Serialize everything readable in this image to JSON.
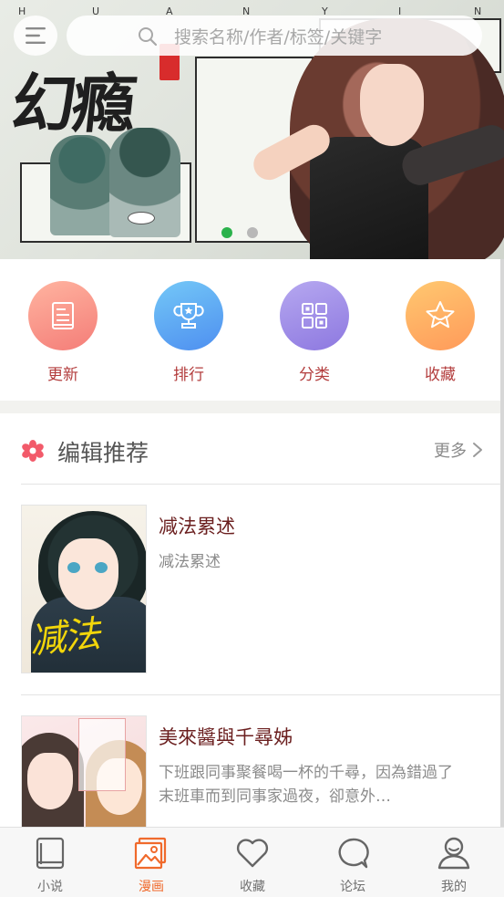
{
  "banner": {
    "letters": [
      "H",
      "U",
      "A",
      "N",
      "Y",
      "I",
      "N"
    ],
    "stamp_text": "",
    "title_art": "幻瘾",
    "slides_count": 2,
    "active_slide": 1
  },
  "search": {
    "placeholder": "搜索名称/作者/标签/关键字"
  },
  "quick_nav": [
    {
      "label": "更新",
      "icon": "book-icon",
      "color_from": "#ffb4a0",
      "color_to": "#f47d78"
    },
    {
      "label": "排行",
      "icon": "trophy-icon",
      "color_from": "#74c8f7",
      "color_to": "#4e8ff0"
    },
    {
      "label": "分类",
      "icon": "grid-icon",
      "color_from": "#b6a8f0",
      "color_to": "#8d78e0"
    },
    {
      "label": "收藏",
      "icon": "star-icon",
      "color_from": "#ffc870",
      "color_to": "#ff9a5a"
    }
  ],
  "editor_picks": {
    "title": "编辑推荐",
    "more_label": "更多",
    "items": [
      {
        "title": "减法累述",
        "description": "减法累述"
      },
      {
        "title": "美來醬與千尋姊",
        "description": "下班跟同事聚餐喝一杯的千尋，因為錯過了末班車而到同事家過夜，卻意外…"
      }
    ]
  },
  "tabs": [
    {
      "label": "小说",
      "icon": "novel-book-icon",
      "active": false
    },
    {
      "label": "漫画",
      "icon": "comic-picture-icon",
      "active": true
    },
    {
      "label": "收藏",
      "icon": "heart-icon",
      "active": false
    },
    {
      "label": "论坛",
      "icon": "chat-bubble-icon",
      "active": false
    },
    {
      "label": "我的",
      "icon": "user-icon",
      "active": false
    }
  ],
  "colors": {
    "accent": "#f06a2c",
    "nav_label": "#b33d3d",
    "comic_title": "#6b1f1f",
    "active_dot": "#2bb24c"
  }
}
